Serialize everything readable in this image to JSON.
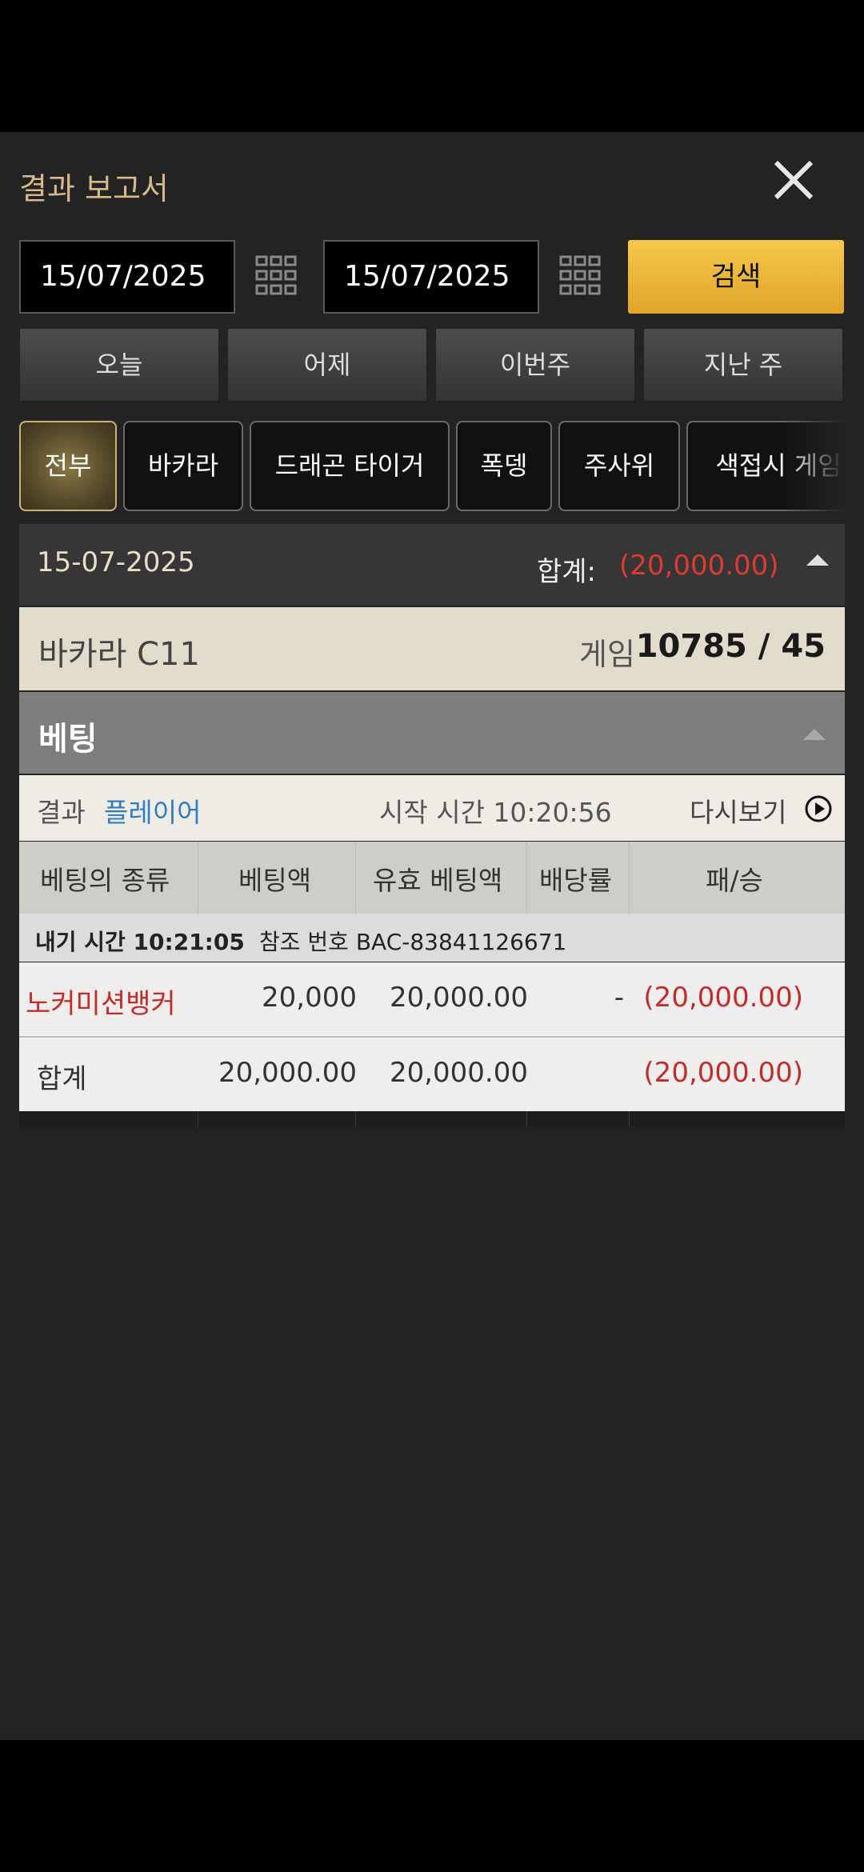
{
  "header": {
    "title": "결과 보고서"
  },
  "filters": {
    "start_date": "15/07/2025",
    "end_date": "15/07/2025",
    "search_label": "검색",
    "quick": [
      "오늘",
      "어제",
      "이번주",
      "지난 주"
    ]
  },
  "tabs": [
    "전부",
    "바카라",
    "드래곤 타이거",
    "폭뎅",
    "주사위",
    "색접시 게임"
  ],
  "summary": {
    "date": "15-07-2025",
    "total_label": "합계:",
    "total_value": "(20,000.00)"
  },
  "game": {
    "name": "바카라 C11",
    "game_label": "게임",
    "game_value": "10785 / 45"
  },
  "bet_section": {
    "title": "베팅"
  },
  "result": {
    "label": "결과",
    "value": "플레이어",
    "start_time": "시작 시간 10:20:56",
    "replay": "다시보기"
  },
  "table": {
    "headers": [
      "베팅의 종류",
      "베팅액",
      "유효 베팅액",
      "배당률",
      "패/승"
    ],
    "ref_time": "내기 시간 10:21:05",
    "ref_no": "참조 번호 BAC-83841126671",
    "rows": [
      {
        "type": "노커미션뱅커",
        "bet": "20,000",
        "valid": "20,000.00",
        "odds": "-",
        "result": "(20,000.00)"
      }
    ],
    "total": {
      "label": "합계",
      "bet": "20,000.00",
      "valid": "20,000.00",
      "result": "(20,000.00)"
    }
  },
  "colors": {
    "accent": "#f6c84b",
    "negative": "#c22c2c",
    "link": "#2f7ec0"
  }
}
